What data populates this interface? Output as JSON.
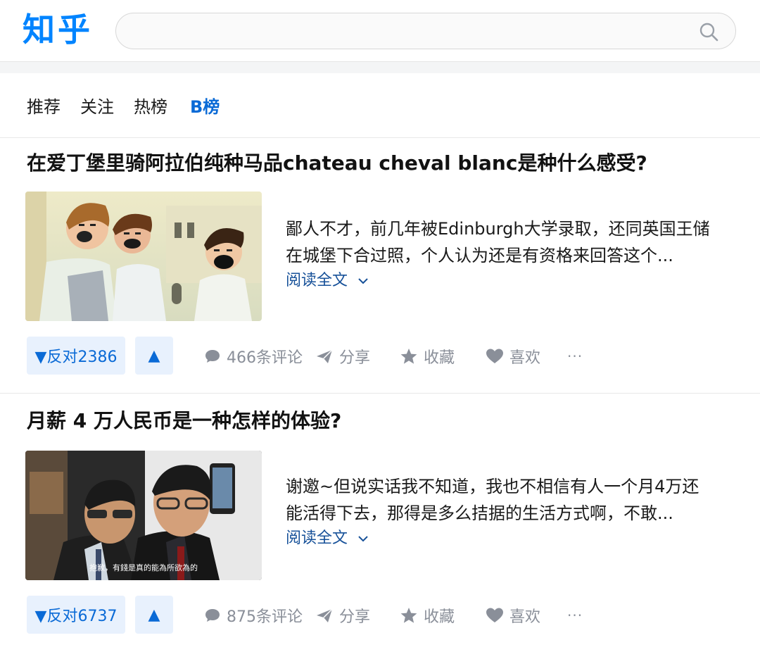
{
  "header": {
    "logo": "知乎",
    "search_placeholder": ""
  },
  "tabs": [
    {
      "label": "推荐",
      "active": false
    },
    {
      "label": "关注",
      "active": false
    },
    {
      "label": "热榜",
      "active": false
    },
    {
      "label": "B榜",
      "active": true
    }
  ],
  "items": [
    {
      "title": "在爱丁堡里骑阿拉伯纯种马品chateau cheval blanc是种什么感受?",
      "excerpt_line1": "鄙人不才，前几年被Edinburgh大学录取，还同英国王储",
      "excerpt_line2": "在城堡下合过照，个人认为还是有资格来回答这个...",
      "read_more": "阅读全文",
      "vote_down_label": "▼反对2386",
      "vote_up_label": "▲",
      "comments": "466条评论",
      "share": "分享",
      "favorite": "收藏",
      "like": "喜欢",
      "more": "···"
    },
    {
      "title": "月薪 4 万人民币是一种怎样的体验?",
      "excerpt_line1": "谢邀~但说实话我不知道，我也不相信有人一个月4万还",
      "excerpt_line2": "能活得下去，那得是多么拮据的生活方式啊，不敢...",
      "read_more": "阅读全文",
      "vote_down_label": "▼反对6737",
      "vote_up_label": "▲",
      "comments": "875条评论",
      "share": "分享",
      "favorite": "收藏",
      "like": "喜欢",
      "more": "···",
      "image_subtitle": "抱歉，有錢是真的能為所欲為的"
    }
  ],
  "colors": {
    "brand": "#0084ff",
    "active_tab": "#0a6ad6",
    "vote_bg": "#e8f1fd",
    "link": "#175199",
    "meta": "#8a8f99"
  }
}
